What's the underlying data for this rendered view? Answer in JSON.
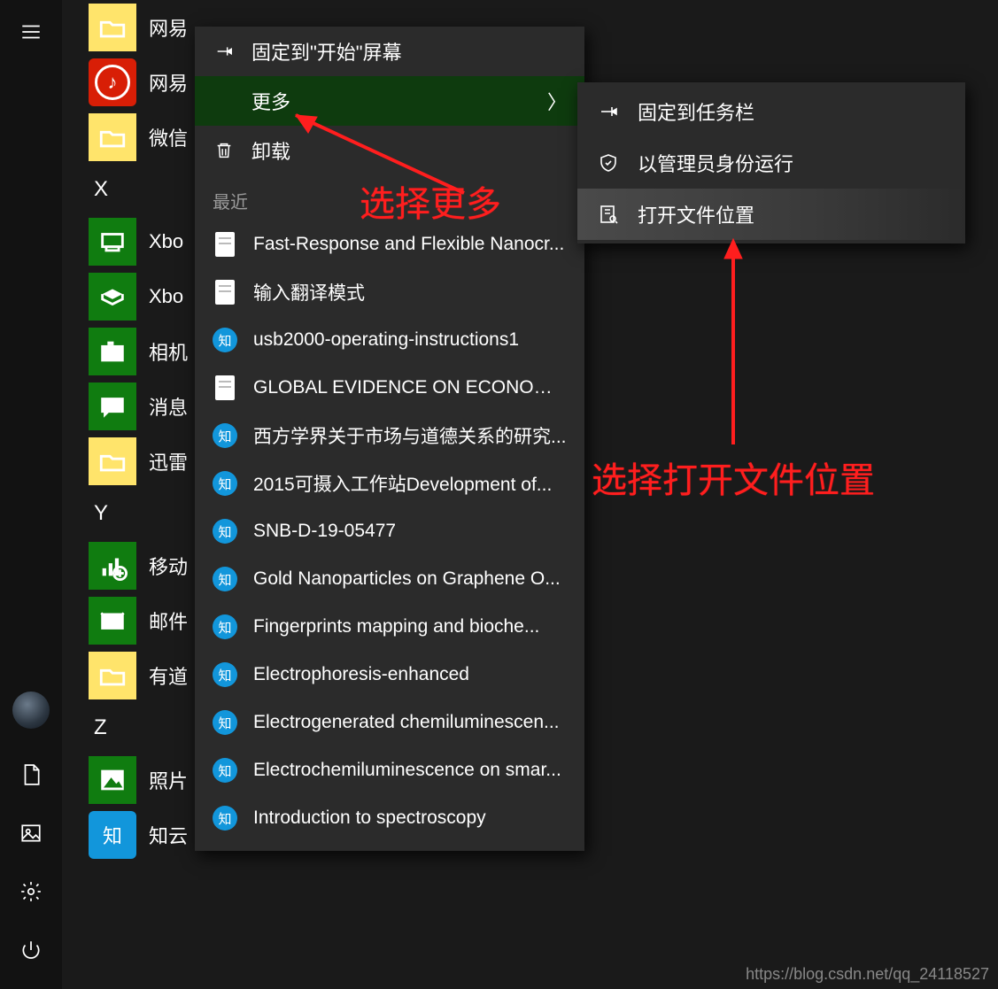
{
  "rail": {
    "hamburger": "menu",
    "avatar": "user-avatar",
    "documents": "documents",
    "pictures": "pictures",
    "settings": "settings",
    "power": "power"
  },
  "apps": [
    {
      "tile": "folder",
      "label": "网易"
    },
    {
      "tile": "netease-music",
      "label": "网易"
    },
    {
      "tile": "folder",
      "label": "微信"
    },
    {
      "header": "X"
    },
    {
      "tile": "xbox-console",
      "label": "Xbo"
    },
    {
      "tile": "xbox",
      "label": "Xbo"
    },
    {
      "tile": "camera",
      "label": "相机"
    },
    {
      "tile": "messages",
      "label": "消息"
    },
    {
      "tile": "folder",
      "label": "迅雷"
    },
    {
      "header": "Y"
    },
    {
      "tile": "mobile-plan",
      "label": "移动"
    },
    {
      "tile": "mail",
      "label": "邮件"
    },
    {
      "tile": "folder",
      "label": "有道"
    },
    {
      "header": "Z"
    },
    {
      "tile": "photos",
      "label": "照片"
    },
    {
      "tile": "zhiyun",
      "label": "知云"
    }
  ],
  "context_menu": {
    "pin_to_start": "固定到\"开始\"屏幕",
    "more": "更多",
    "uninstall": "卸载",
    "recent_header": "最近",
    "recent": [
      {
        "icon": "doc",
        "label": "Fast-Response and Flexible Nanocr..."
      },
      {
        "icon": "doc",
        "label": "输入翻译模式"
      },
      {
        "icon": "zhi",
        "label": "usb2000-operating-instructions1"
      },
      {
        "icon": "doc",
        "label": "GLOBAL EVIDENCE ON ECONOMI..."
      },
      {
        "icon": "zhi",
        "label": "西方学界关于市场与道德关系的研究..."
      },
      {
        "icon": "zhi",
        "label": "2015可摄入工作站Development of..."
      },
      {
        "icon": "zhi",
        "label": "SNB-D-19-05477"
      },
      {
        "icon": "zhi",
        "label": "Gold Nanoparticles on Graphene O..."
      },
      {
        "icon": "zhi",
        "label": "Fingerprints mapping and bioche..."
      },
      {
        "icon": "zhi",
        "label": "Electrophoresis-enhanced"
      },
      {
        "icon": "zhi",
        "label": "Electrogenerated chemiluminescen..."
      },
      {
        "icon": "zhi",
        "label": "Electrochemiluminescence on smar..."
      },
      {
        "icon": "zhi",
        "label": "Introduction to spectroscopy"
      }
    ]
  },
  "submenu": {
    "pin_to_taskbar": "固定到任务栏",
    "run_as_admin": "以管理员身份运行",
    "open_file_location": "打开文件位置"
  },
  "annotations": {
    "select_more": "选择更多",
    "select_open_file_location": "选择打开文件位置"
  },
  "watermark": "https://blog.csdn.net/qq_24118527"
}
